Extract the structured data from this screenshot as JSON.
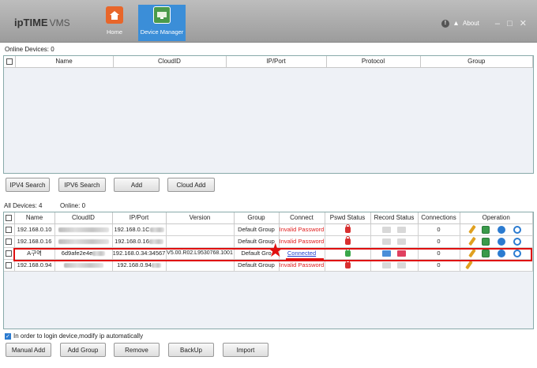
{
  "app": {
    "logo_brand": "ipTIME",
    "logo_product": "VMS",
    "nav": [
      {
        "label": "Home",
        "icon": "home-icon"
      },
      {
        "label": "Device Manager",
        "icon": "device-manager-icon"
      }
    ],
    "about": "About"
  },
  "online": {
    "count_label": "Online Devices:  0",
    "columns": [
      "Name",
      "CloudID",
      "IP/Port",
      "Protocol",
      "Group"
    ]
  },
  "search_buttons": [
    "IPV4 Search",
    "IPV6 Search",
    "Add",
    "Cloud Add"
  ],
  "all": {
    "count_label": "All Devices:  4",
    "online_label": "Online:  0",
    "columns": [
      "Name",
      "CloudID",
      "IP/Port",
      "Version",
      "Group",
      "Connect",
      "Pswd Status",
      "Record Status",
      "Connections",
      "Operation"
    ],
    "rows": [
      {
        "name": "192.168.0.10",
        "ip": "192.168.0.1C",
        "version": "",
        "group": "Default Group",
        "connect": "Invalid Password",
        "connections": "0",
        "status": "invalid"
      },
      {
        "name": "192.168.0.16",
        "ip": "192.168.0.16",
        "version": "",
        "group": "Default Group",
        "connect": "Invalid Password",
        "connections": "0",
        "status": "invalid"
      },
      {
        "name": "A구역",
        "cloudid": "6d9afe2e4e",
        "ip": "192.168.0.34:34567",
        "version": "V5.00.R02.L9530768.1001",
        "group": "Default Gro",
        "connect": "Connected",
        "connections": "0",
        "status": "connected"
      },
      {
        "name": "192.168.0.94",
        "ip": "192.168.0.94",
        "version": "",
        "group": "Default Group",
        "connect": "Invalid Password",
        "connections": "0",
        "status": "invalid"
      }
    ]
  },
  "auto_ip": "In order to login device,modify ip automatically",
  "bottom_buttons": [
    "Manual Add",
    "Add Group",
    "Remove",
    "BackUp",
    "Import"
  ],
  "colors": {
    "accent": "#3b8ed8",
    "error": "#e02020",
    "highlight": "#e01010"
  }
}
